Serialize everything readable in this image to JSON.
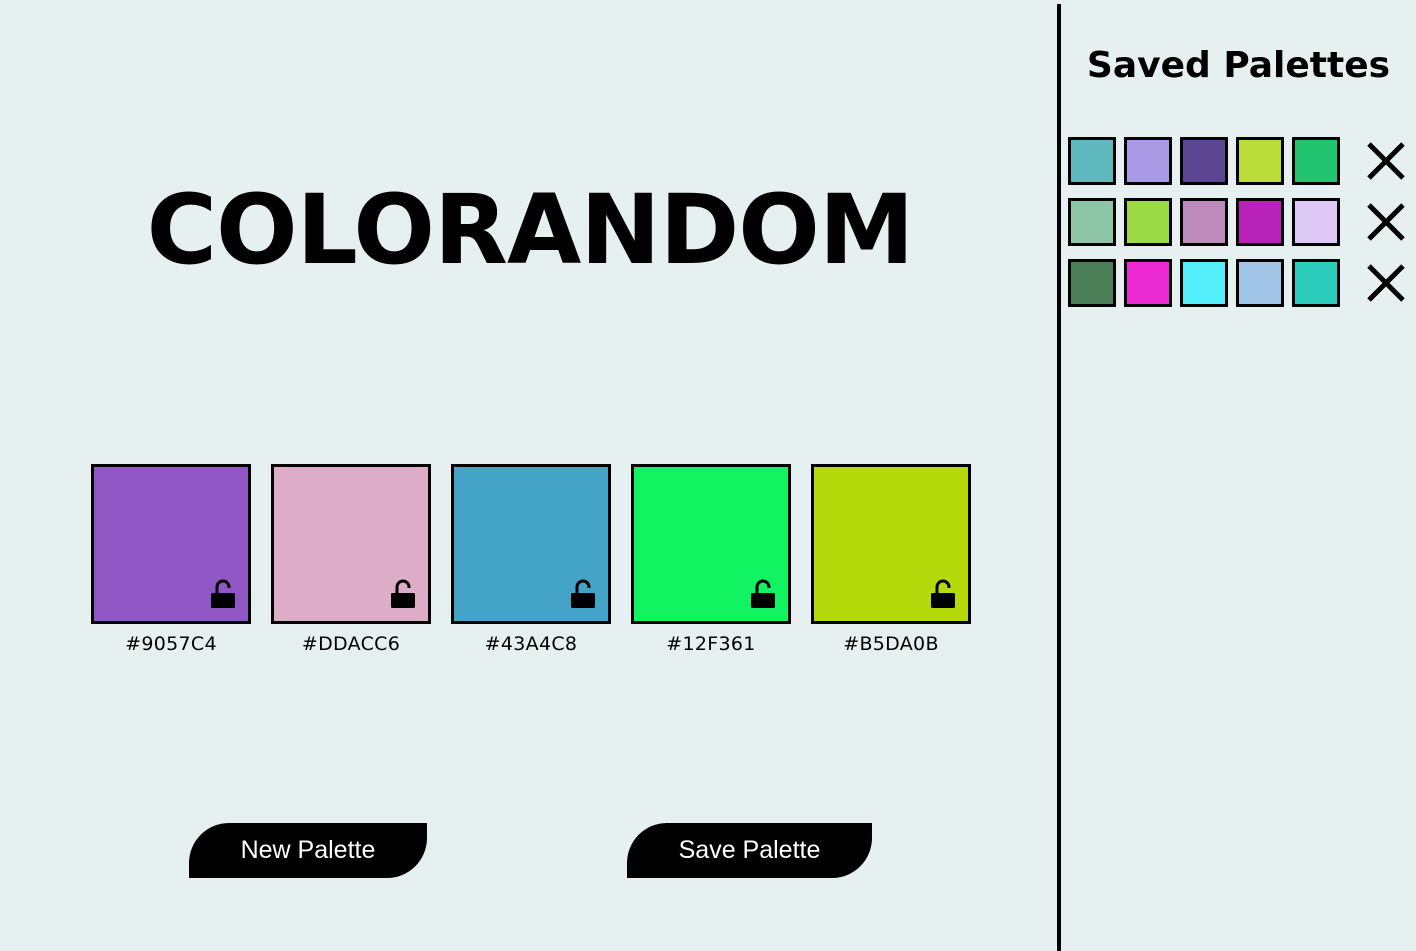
{
  "app": {
    "title": "COLORANDOM"
  },
  "current_palette": [
    {
      "hex": "#9057C4",
      "color": "#9057C4",
      "lock_icon": "unlocked-padlock-icon"
    },
    {
      "hex": "#DDACC6",
      "color": "#DDACC6",
      "lock_icon": "unlocked-padlock-icon"
    },
    {
      "hex": "#43A4C8",
      "color": "#43A4C8",
      "lock_icon": "unlocked-padlock-icon"
    },
    {
      "hex": "#12F361",
      "color": "#12F361",
      "lock_icon": "unlocked-padlock-icon"
    },
    {
      "hex": "#B5DA0B",
      "color": "#B5DA0B",
      "lock_icon": "unlocked-padlock-icon"
    }
  ],
  "buttons": {
    "new_palette": "New Palette",
    "save_palette": "Save Palette"
  },
  "sidebar": {
    "title": "Saved Palettes",
    "delete_icon": "close-x-icon",
    "saved_palettes": [
      [
        "#5FB8BE",
        "#A99AE6",
        "#5C4691",
        "#BCDC3A",
        "#22C470"
      ],
      [
        "#8EC5A8",
        "#9BDB45",
        "#BC8ABB",
        "#B922B8",
        "#DEC8F5"
      ],
      [
        "#4A7F57",
        "#EB2AD4",
        "#53EEF9",
        "#9FC4E6",
        "#2DCDBE"
      ]
    ]
  },
  "theme": {
    "background": "#E7F0F1",
    "text": "#000000",
    "button_bg": "#000000",
    "button_text": "#FFFFFF"
  }
}
